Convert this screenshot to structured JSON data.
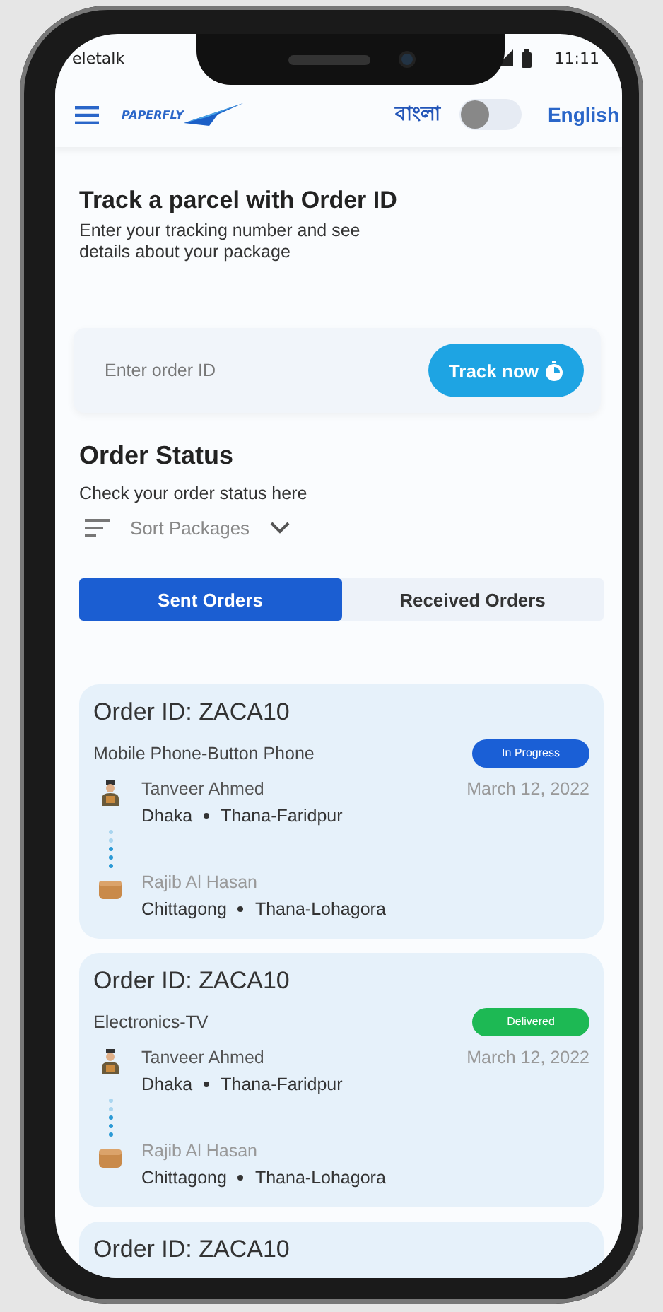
{
  "status_bar": {
    "carrier": "eletalk",
    "time": "11:11"
  },
  "header": {
    "logo": "PAPERFLY",
    "language_left": "বাংলা",
    "language_toggle": {
      "on": false
    },
    "language_right": "English"
  },
  "track": {
    "title": "Track a parcel with Order ID",
    "subtitle": "Enter your tracking number and see details about your package",
    "input": {
      "placeholder": "Enter order ID"
    },
    "button": "Track now"
  },
  "order_status": {
    "title": "Order Status",
    "subtitle": "Check your order status here",
    "sort": "Sort Packages",
    "tabs": [
      {
        "label": "Sent Orders",
        "selected": true
      },
      {
        "label": "Received Orders",
        "selected": false
      }
    ],
    "orders": [
      {
        "order_id": "Order ID: ZACA10",
        "product": "Mobile Phone-Button Phone",
        "status": "In Progress",
        "color": "#1a5fd6",
        "sender": "Tanveer Ahmed",
        "sender_city": "Dhaka",
        "sender_area": "Thana-Faridpur",
        "date": "March 12, 2022",
        "receiver": "Rajib Al Hasan",
        "receiver_city": "Chittagong",
        "receiver_area": "Thana-Lohagora"
      },
      {
        "order_id": "Order ID: ZACA10",
        "product": "Electronics-TV",
        "status": "Delivered",
        "color": "#1db954",
        "sender": "Tanveer Ahmed",
        "sender_city": "Dhaka",
        "sender_area": "Thana-Faridpur",
        "date": "March 12, 2022",
        "receiver": "Rajib Al Hasan",
        "receiver_city": "Chittagong",
        "receiver_area": "Thana-Lohagora"
      },
      {
        "order_id": "Order ID: ZACA10"
      }
    ]
  }
}
